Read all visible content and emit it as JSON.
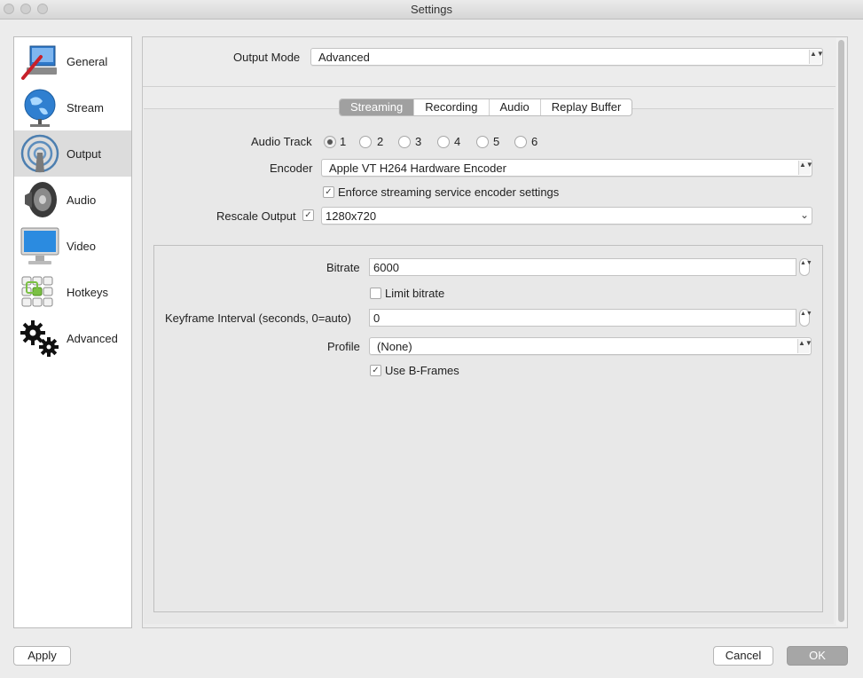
{
  "window": {
    "title": "Settings"
  },
  "sidebar": {
    "items": [
      {
        "label": "General",
        "icon": "general-icon"
      },
      {
        "label": "Stream",
        "icon": "globe-icon"
      },
      {
        "label": "Output",
        "icon": "broadcast-icon",
        "active": true
      },
      {
        "label": "Audio",
        "icon": "speaker-icon"
      },
      {
        "label": "Video",
        "icon": "monitor-icon"
      },
      {
        "label": "Hotkeys",
        "icon": "keyboard-icon"
      },
      {
        "label": "Advanced",
        "icon": "gears-icon"
      }
    ]
  },
  "output_mode": {
    "label": "Output Mode",
    "value": "Advanced"
  },
  "tabs": [
    {
      "label": "Streaming",
      "active": true
    },
    {
      "label": "Recording"
    },
    {
      "label": "Audio"
    },
    {
      "label": "Replay Buffer"
    }
  ],
  "streaming": {
    "audio_track": {
      "label": "Audio Track",
      "options": [
        "1",
        "2",
        "3",
        "4",
        "5",
        "6"
      ],
      "selected": "1"
    },
    "encoder": {
      "label": "Encoder",
      "value": "Apple VT H264 Hardware Encoder"
    },
    "enforce": {
      "label": "Enforce streaming service encoder settings",
      "checked": true
    },
    "rescale": {
      "label": "Rescale Output",
      "checked": true,
      "value": "1280x720"
    },
    "bitrate": {
      "label": "Bitrate",
      "value": "6000"
    },
    "limit_bitrate": {
      "label": "Limit bitrate",
      "checked": false
    },
    "keyframe": {
      "label": "Keyframe Interval (seconds, 0=auto)",
      "value": "0"
    },
    "profile": {
      "label": "Profile",
      "value": "(None)"
    },
    "bframes": {
      "label": "Use B-Frames",
      "checked": true
    }
  },
  "buttons": {
    "apply": "Apply",
    "cancel": "Cancel",
    "ok": "OK"
  },
  "glyphs": {
    "check": "✓",
    "updown": "▲▼",
    "down": "⌄"
  }
}
